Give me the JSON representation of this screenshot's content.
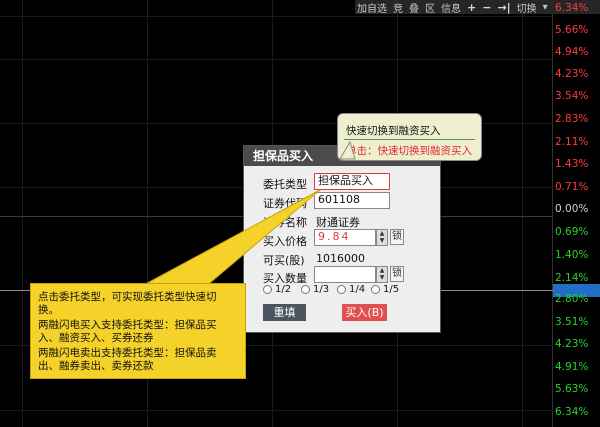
{
  "toolbar": {
    "add_watch": "加自选",
    "compete": "竞",
    "overlay": "叠",
    "region": "区",
    "info": "信息",
    "plus": "+",
    "minus": "−",
    "switch_arrow": "→|",
    "switch_label": "切换",
    "dropdown": "▾"
  },
  "axis": {
    "labels": [
      "6.34%",
      "5.66%",
      "4.94%",
      "4.23%",
      "3.54%",
      "2.83%",
      "2.11%",
      "1.43%",
      "0.71%",
      "0.00%",
      "0.69%",
      "1.40%",
      "2.14%",
      "2.80%",
      "3.51%",
      "4.23%",
      "4.91%",
      "5.63%",
      "6.34%"
    ],
    "colors": {
      "up": "#ff3b3b",
      "flat": "#d0d0d0",
      "down": "#2bd12b",
      "highlight": "#1f6fc5"
    }
  },
  "dialog": {
    "title": "担保品买入",
    "entrust_type_label": "委托类型",
    "entrust_type_value": "担保品买入",
    "code_label": "证券代码",
    "code_value": "601108",
    "name_label": "证券名称",
    "name_value": "财通证券",
    "price_label": "买入价格",
    "price_value": "9.84",
    "lock": "锁",
    "avail_label": "可买(股)",
    "avail_value": "1016000",
    "qty_label": "买入数量",
    "qty_value": "",
    "fractions": [
      "1/2",
      "1/3",
      "1/4",
      "1/5"
    ],
    "reset_button": "重填",
    "buy_button": "买入(B)"
  },
  "tooltip": {
    "title": "快速切换到融资买入",
    "click_hint": "单击：快速切换到融资买入"
  },
  "callout": {
    "lines": [
      "点击委托类型，可实现委托类型快速切",
      "换。",
      "两融闪电买入支持委托类型：担保品买",
      "入、融资买入、买券还券",
      "两融闪电卖出支持委托类型：担保品卖",
      "出、融券卖出、卖券还款"
    ]
  }
}
